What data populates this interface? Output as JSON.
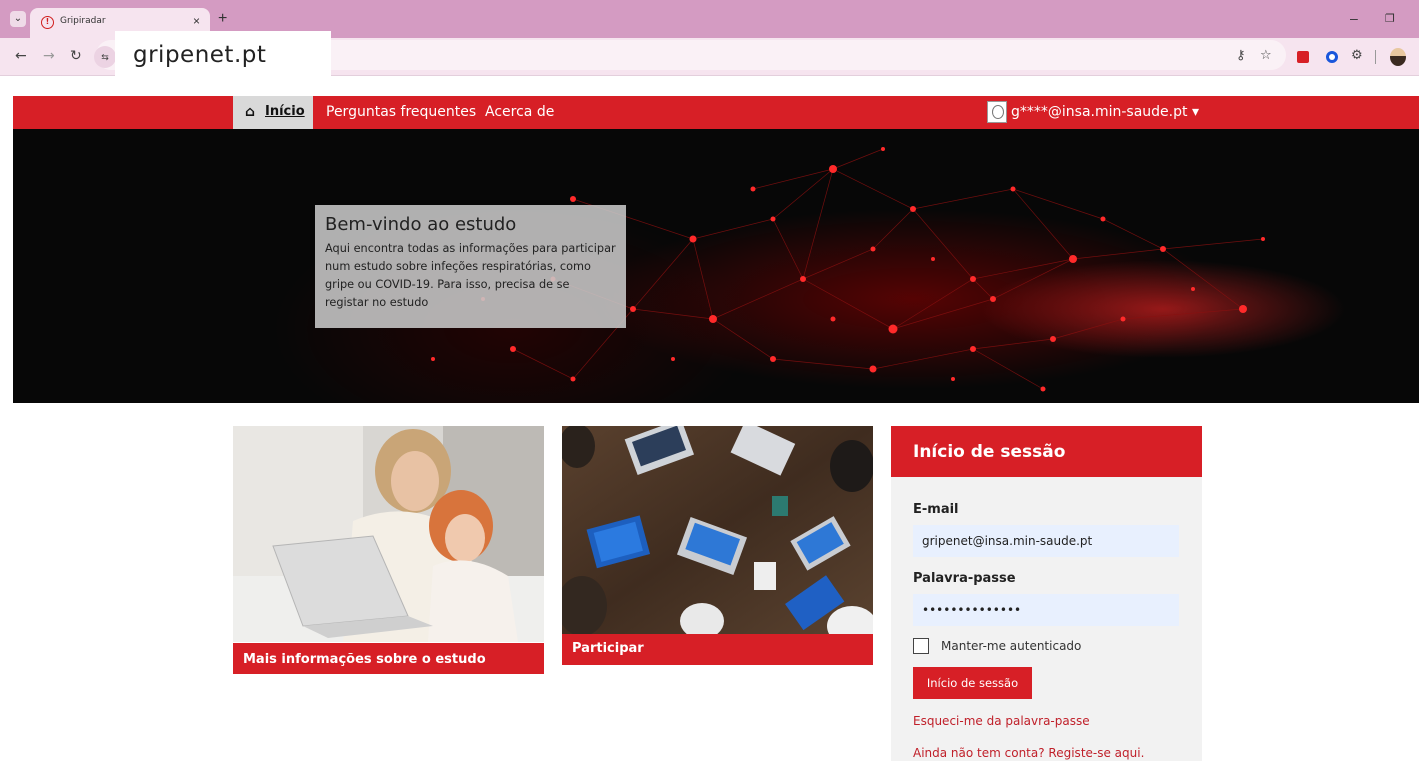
{
  "browser": {
    "tab_title": "Gripiradar",
    "tab_favicon_glyph": "!",
    "close_glyph": "×",
    "new_tab_glyph": "+",
    "tab_list_glyph": "⌄",
    "url": "gripenet.pt",
    "icons": [
      "back-icon",
      "forward-icon",
      "reload-icon",
      "site-info-icon",
      "password-key-icon",
      "bookmark-star-icon",
      "extension-red-icon",
      "extension-blue-icon",
      "extensions-puzzle-icon",
      "profile-avatar-icon"
    ],
    "glyphs": {
      "back": "←",
      "forward": "→",
      "reload": "↻",
      "site_info": "⇆",
      "key": "⚷",
      "star": "☆",
      "puzzle": "⚙",
      "minimize": "–",
      "restore": "❐"
    }
  },
  "nav": {
    "home_glyph": "⌂",
    "home": "Início",
    "faq": "Perguntas frequentes",
    "about": "Acerca de",
    "user_email": "g****@insa.min-saude.pt ▾"
  },
  "hero": {
    "title": "Bem-vindo ao estudo",
    "text": "Aqui encontra todas as informações para participar num estudo sobre infeções respiratórias, como gripe ou COVID-19. Para isso, precisa de se registar no estudo"
  },
  "cards": {
    "info": "Mais informações sobre o estudo",
    "participate": "Participar"
  },
  "login": {
    "title": "Início de sessão",
    "email_label": "E-mail",
    "email_value": "gripenet@insa.min-saude.pt",
    "password_label": "Palavra-passe",
    "password_value": "••••••••••••••",
    "remember_label": "Manter-me autenticado",
    "submit": "Início de sessão",
    "forgot": "Esqueci-me da palavra-passe",
    "register": "Ainda não tem conta? Registe-se aqui."
  },
  "colors": {
    "brand_red": "#d71f26",
    "tab_strip": "#d49bc2",
    "toolbar": "#f6e4ef",
    "autofill_blue": "#e8f0fe"
  }
}
